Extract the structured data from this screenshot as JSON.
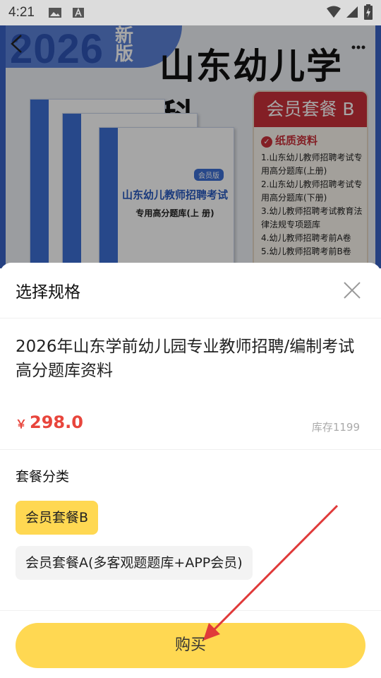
{
  "status_bar": {
    "time": "4:21"
  },
  "hero": {
    "year": "2026",
    "new_tag": "新版",
    "title": "山东幼儿学科",
    "book": {
      "title": "山东幼儿教师招聘考试",
      "subtitle": "专用高分题库(上 册)",
      "tag": "会员版"
    },
    "package": {
      "header": "会员套餐 B",
      "subheader": "纸质资料",
      "items": [
        "1.山东幼儿教师招聘考试专用高分题库(上册)",
        "2.山东幼儿教师招聘考试专用高分题库(下册)",
        "3.幼儿教师招聘考试教育法律法规专项题库",
        "4.幼儿教师招聘考前A卷",
        "5.幼儿教师招聘考前B卷"
      ]
    }
  },
  "sheet": {
    "title": "选择规格",
    "product_name": "2026年山东学前幼儿园专业教师招聘/编制考试高分题库资料",
    "price_currency": "￥",
    "price": "298.0",
    "stock": "库存1199",
    "category_title": "套餐分类",
    "options": [
      {
        "label": "会员套餐B",
        "selected": true
      },
      {
        "label": "会员套餐A(多客观题题库+APP会员)",
        "selected": false
      }
    ],
    "buy_label": "购买"
  },
  "colors": {
    "accent": "#ffd852",
    "price": "#e8453c",
    "arrow": "#e03a3a"
  }
}
